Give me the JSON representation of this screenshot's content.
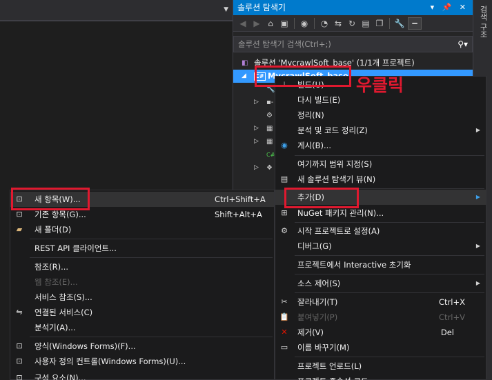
{
  "solution_explorer": {
    "title": "솔루션 탐색기",
    "title_buttons": "▾ 📌 ✕",
    "search_placeholder": "솔루션 탐색기 검색(Ctrl+;)",
    "solution_label": "솔루션 'MycrawlSoft_base' (1/1개 프로젝트)",
    "project_label": "MycrawlSoft_base"
  },
  "right_strip": {
    "tab": "검색 구조"
  },
  "annotation": {
    "text": "우클릭"
  },
  "context_menu": {
    "items": [
      {
        "label": "빌드(U)"
      },
      {
        "label": "다시 빌드(E)"
      },
      {
        "label": "정리(N)"
      },
      {
        "label": "분석 및 코드 정리(Z)"
      },
      {
        "label": "게시(B)..."
      },
      {
        "label": "여기까지 범위 지정(S)"
      },
      {
        "label": "새 솔루션 탐색기 뷰(N)"
      },
      {
        "label": "추가(D)"
      },
      {
        "label": "NuGet 패키지 관리(N)..."
      },
      {
        "label": "시작 프로젝트로 설정(A)"
      },
      {
        "label": "디버그(G)"
      },
      {
        "label": "프로젝트에서 Interactive 초기화"
      },
      {
        "label": "소스 제어(S)"
      },
      {
        "label": "잘라내기(T)",
        "shortcut": "Ctrl+X"
      },
      {
        "label": "붙여넣기(P)",
        "shortcut": "Ctrl+V"
      },
      {
        "label": "제거(V)",
        "shortcut": "Del"
      },
      {
        "label": "이름 바꾸기(M)"
      },
      {
        "label": "프로젝트 언로드(L)"
      },
      {
        "label": "프로젝트 종속성 로드"
      }
    ]
  },
  "add_submenu": {
    "items": [
      {
        "label": "새 항목(W)...",
        "shortcut": "Ctrl+Shift+A"
      },
      {
        "label": "기존 항목(G)...",
        "shortcut": "Shift+Alt+A"
      },
      {
        "label": "새 폴더(D)"
      },
      {
        "label": "REST API 클라이언트..."
      },
      {
        "label": "참조(R)..."
      },
      {
        "label": "웹 참조(E)..."
      },
      {
        "label": "서비스 참조(S)..."
      },
      {
        "label": "연결된 서비스(C)"
      },
      {
        "label": "분석기(A)..."
      },
      {
        "label": "양식(Windows Forms)(F)..."
      },
      {
        "label": "사용자 정의 컨트롤(Windows Forms)(U)..."
      },
      {
        "label": "구성 요소(N)..."
      }
    ]
  },
  "colors": {
    "accent": "#007acc",
    "selection": "#3399ff",
    "highlight": "#e0192f"
  }
}
